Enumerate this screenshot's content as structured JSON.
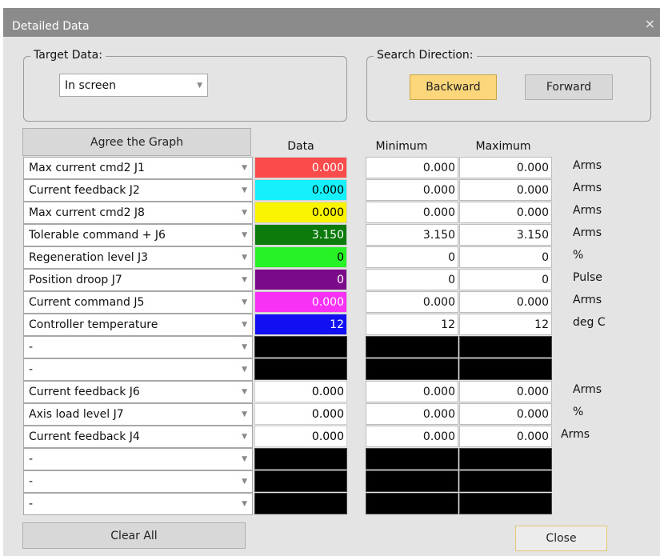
{
  "window": {
    "title": "Detailed Data",
    "close_glyph": "×"
  },
  "target_data": {
    "legend": "Target Data:",
    "value": "In screen"
  },
  "search_direction": {
    "legend": "Search Direction:",
    "backward_label": "Backward",
    "forward_label": "Forward"
  },
  "agree_graph_label": "Agree the Graph",
  "headers": {
    "data": "Data",
    "minimum": "Minimum",
    "maximum": "Maximum"
  },
  "rows": [
    {
      "name": "Max current cmd2 J1",
      "data": "0.000",
      "min": "0.000",
      "max": "0.000",
      "unit": "Arms",
      "color": "#fb4b4b",
      "text_color": "#ffffff"
    },
    {
      "name": "Current feedback J2",
      "data": "0.000",
      "min": "0.000",
      "max": "0.000",
      "unit": "Arms",
      "color": "#16f0fb",
      "text_color": "#000000"
    },
    {
      "name": "Max current cmd2 J8",
      "data": "0.000",
      "min": "0.000",
      "max": "0.000",
      "unit": "Arms",
      "color": "#fbf400",
      "text_color": "#000000"
    },
    {
      "name": "Tolerable command + J6",
      "data": "3.150",
      "min": "3.150",
      "max": "3.150",
      "unit": "Arms",
      "color": "#0c7b0c",
      "text_color": "#ffffff"
    },
    {
      "name": "Regeneration level J3",
      "data": "0",
      "min": "0",
      "max": "0",
      "unit": "%",
      "color": "#26f226",
      "text_color": "#000000"
    },
    {
      "name": "Position droop J7",
      "data": "0",
      "min": "0",
      "max": "0",
      "unit": "Pulse",
      "color": "#7a0a8a",
      "text_color": "#ffffff"
    },
    {
      "name": "Current command J5",
      "data": "0.000",
      "min": "0.000",
      "max": "0.000",
      "unit": "Arms",
      "color": "#f832f5",
      "text_color": "#ffffff"
    },
    {
      "name": "Controller temperature",
      "data": "12",
      "min": "12",
      "max": "12",
      "unit": "deg C",
      "color": "#1010f2",
      "text_color": "#ffffff"
    },
    {
      "name": "-",
      "data": "",
      "min": "",
      "max": "",
      "unit": "",
      "color": "#000000",
      "text_color": "#000000",
      "empty": true
    },
    {
      "name": "-",
      "data": "",
      "min": "",
      "max": "",
      "unit": "",
      "color": "#000000",
      "text_color": "#000000",
      "empty": true
    },
    {
      "name": "Current feedback J6",
      "data": "0.000",
      "min": "0.000",
      "max": "0.000",
      "unit": "Arms",
      "color": "#ffffff",
      "text_color": "#000000"
    },
    {
      "name": "Axis load level J7",
      "data": "0.000",
      "min": "0.000",
      "max": "0.000",
      "unit": "%",
      "color": "#ffffff",
      "text_color": "#000000"
    },
    {
      "name": "Current feedback J4",
      "data": "0.000",
      "min": "0.000",
      "max": "0.000",
      "unit": "Arms",
      "color": "#ffffff",
      "text_color": "#000000"
    },
    {
      "name": "-",
      "data": "",
      "min": "",
      "max": "",
      "unit": "",
      "color": "#000000",
      "text_color": "#000000",
      "empty": true
    },
    {
      "name": "-",
      "data": "",
      "min": "",
      "max": "",
      "unit": "",
      "color": "#000000",
      "text_color": "#000000",
      "empty": true
    },
    {
      "name": "-",
      "data": "",
      "min": "",
      "max": "",
      "unit": "",
      "color": "#000000",
      "text_color": "#000000",
      "empty": true
    }
  ],
  "clear_all_label": "Clear All",
  "close_label": "Close"
}
